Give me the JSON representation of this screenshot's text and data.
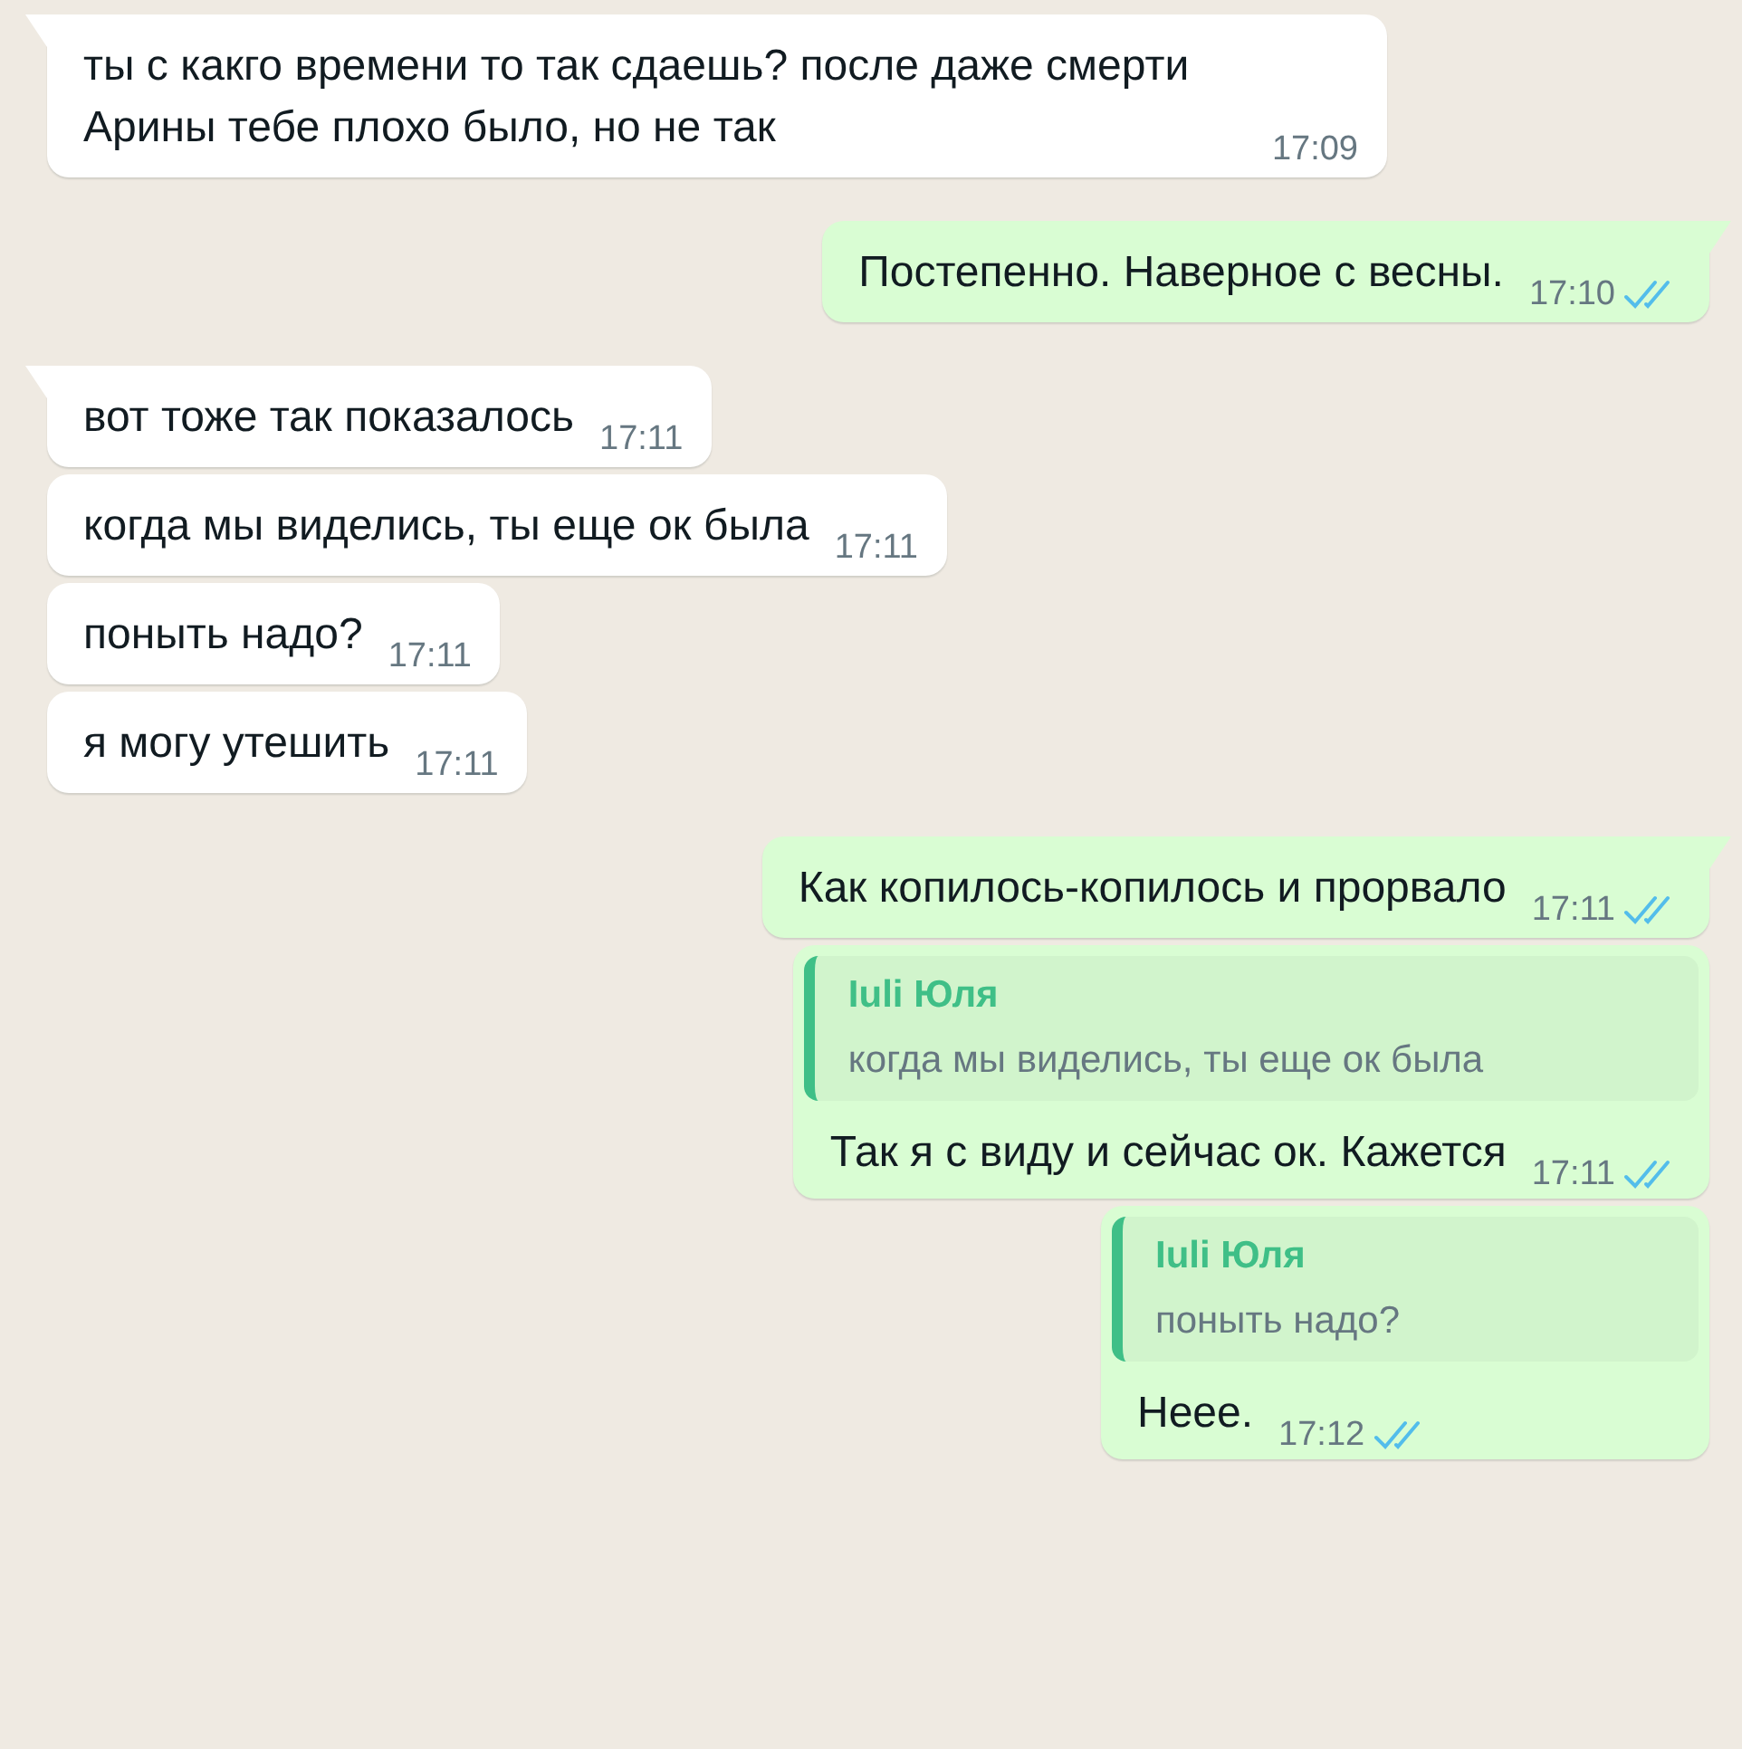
{
  "messages": [
    {
      "kind": "incoming",
      "tail": true,
      "text": "ты с какго времени то так сдаешь? после даже смерти Арины тебе плохо было, но не так",
      "time": "17:09"
    },
    {
      "kind": "outgoing",
      "tail": true,
      "text": "Постепенно. Наверное с весны.",
      "time": "17:10",
      "read": true
    },
    {
      "kind": "incoming",
      "tail": true,
      "text": "вот тоже так показалось",
      "time": "17:11"
    },
    {
      "kind": "incoming",
      "tail": false,
      "text": "когда мы виделись, ты еще ок была",
      "time": "17:11"
    },
    {
      "kind": "incoming",
      "tail": false,
      "text": "поныть надо?",
      "time": "17:11"
    },
    {
      "kind": "incoming",
      "tail": false,
      "text": "я могу утешить",
      "time": "17:11"
    },
    {
      "kind": "outgoing",
      "tail": true,
      "text": "Как копилось-копилось и прорвало",
      "time": "17:11",
      "read": true
    },
    {
      "kind": "outgoing",
      "tail": false,
      "quote": {
        "author": "Iuli Юля",
        "text": "когда мы виделись, ты еще ок была"
      },
      "text": "Так я с виду и сейчас ок. Кажется",
      "time": "17:11",
      "read": true
    },
    {
      "kind": "outgoing",
      "tail": false,
      "quote": {
        "author": "Iuli Юля",
        "text": "поныть надо?"
      },
      "text": "Неее.",
      "time": "17:12",
      "read": true
    }
  ]
}
